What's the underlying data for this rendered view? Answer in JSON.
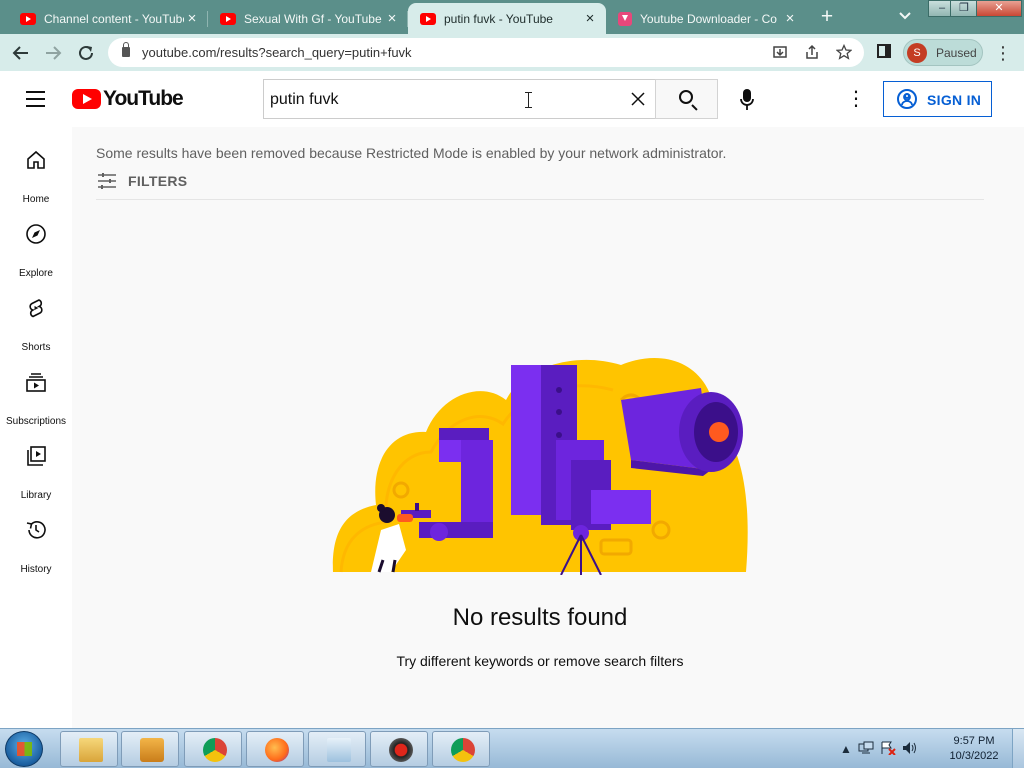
{
  "browser": {
    "tabs": [
      {
        "title": "Channel content - YouTube",
        "favicon": "youtube-icon",
        "active": false
      },
      {
        "title": "Sexual With Gf - YouTube",
        "favicon": "youtube-icon",
        "active": false
      },
      {
        "title": "putin fuvk - YouTube",
        "favicon": "youtube-icon",
        "active": true
      },
      {
        "title": "Youtube Downloader - Co",
        "favicon": "download-icon",
        "active": false
      }
    ],
    "new_tab_symbol": "+",
    "url": "youtube.com/results?search_query=putin+fuvk",
    "profile": {
      "initial": "S",
      "status": "Paused"
    },
    "accent_color": "#5b8f8a"
  },
  "youtube": {
    "logo_text": "YouTube",
    "search": {
      "query": "putin fuvk"
    },
    "sign_in_label": "SIGN IN",
    "guide": [
      {
        "label": "Home",
        "icon": "home-icon"
      },
      {
        "label": "Explore",
        "icon": "compass-icon"
      },
      {
        "label": "Shorts",
        "icon": "shorts-icon"
      },
      {
        "label": "Subscriptions",
        "icon": "subscriptions-icon"
      },
      {
        "label": "Library",
        "icon": "library-icon"
      },
      {
        "label": "History",
        "icon": "history-icon"
      }
    ],
    "restricted_notice": "Some results have been removed because Restricted Mode is enabled by your network administrator.",
    "filters_label": "FILTERS",
    "empty_state": {
      "title": "No results found",
      "hint": "Try different keywords or remove search filters"
    },
    "brand_color": "#ff0000",
    "link_color": "#065fd4"
  },
  "taskbar": {
    "pinned": [
      "explorer-icon",
      "media-player-icon",
      "chrome-icon",
      "firefox-icon",
      "notepad-icon",
      "recorder-icon",
      "chrome-profile-icon"
    ],
    "clock": {
      "time": "9:57 PM",
      "date": "10/3/2022"
    }
  }
}
